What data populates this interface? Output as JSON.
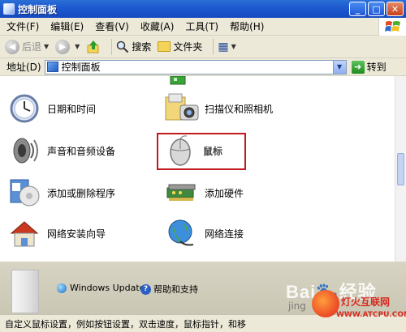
{
  "window": {
    "title": "控制面板",
    "buttons": {
      "minimize": "_",
      "maximize": "□",
      "close": "✕"
    }
  },
  "menu": [
    "文件(F)",
    "编辑(E)",
    "查看(V)",
    "收藏(A)",
    "工具(T)",
    "帮助(H)"
  ],
  "toolbar": {
    "back": "后退",
    "search": "搜索",
    "folders": "文件夹",
    "back_arrow": "◀",
    "forward_arrow": "▶",
    "dropdown": "▼",
    "up_arrow": "↑",
    "views_icon": "▦"
  },
  "address": {
    "label": "地址(D)",
    "value": "控制面板",
    "go": "转到",
    "go_arrow": "➜",
    "dropdown": "▼"
  },
  "items": [
    {
      "name": "date-time",
      "label": "日期和时间"
    },
    {
      "name": "scanners-cameras",
      "label": "扫描仪和照相机"
    },
    {
      "name": "sounds-audio",
      "label": "声音和音频设备"
    },
    {
      "name": "mouse",
      "label": "鼠标"
    },
    {
      "name": "add-remove-programs",
      "label": "添加或删除程序"
    },
    {
      "name": "add-hardware",
      "label": "添加硬件"
    },
    {
      "name": "network-setup-wizard",
      "label": "网络安装向导"
    },
    {
      "name": "network-connections",
      "label": "网络连接"
    }
  ],
  "details": {
    "windows_update": "Windows Update",
    "help_support": "帮助和支持",
    "help_glyph": "?"
  },
  "watermark": {
    "baidu": "Bai🐾经验",
    "jingyan": "jing",
    "site_cn": "灯火互联网",
    "site_url": "WWW.ATCPU.COM"
  },
  "status": {
    "text": "自定义鼠标设置，例如按钮设置，双击速度，鼠标指针，和移"
  },
  "colors": {
    "highlight_border": "#c0191f",
    "titlebar": "#1e5bd1",
    "chrome": "#ece9d8"
  }
}
